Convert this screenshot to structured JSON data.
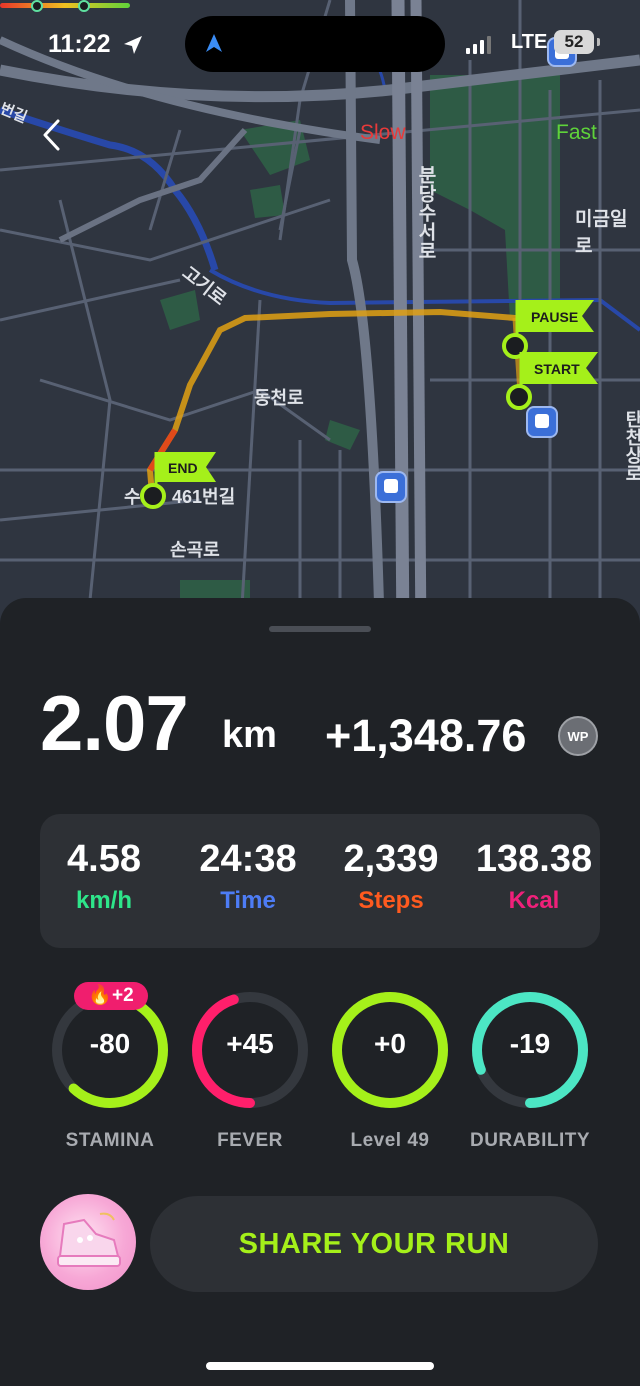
{
  "status_bar": {
    "time": "11:22",
    "network": "LTE",
    "battery": "52"
  },
  "map": {
    "legend": {
      "slow": "Slow",
      "fast": "Fast"
    },
    "road_labels": [
      "분당수서로",
      "미금일로",
      "고기로",
      "동천로",
      "수",
      "461번길",
      "손곡로",
      "탄천상로",
      "번길"
    ],
    "markers": {
      "pause": "PAUSE",
      "start": "START",
      "end": "END"
    }
  },
  "summary": {
    "distance_value": "2.07",
    "distance_unit": "km",
    "wp_amount": "+1,348.76",
    "wp_badge": "WP"
  },
  "stats": [
    {
      "value": "4.58",
      "label": "km/h",
      "color": "#2ee58a"
    },
    {
      "value": "24:38",
      "label": "Time",
      "color": "#4d7cf5"
    },
    {
      "value": "2,339",
      "label": "Steps",
      "color": "#ff5a1f"
    },
    {
      "value": "138.38",
      "label": "Kcal",
      "color": "#f0207a"
    }
  ],
  "rings": [
    {
      "value": "-80",
      "label": "STAMINA",
      "color": "#a5f01a",
      "fill": 0.62
    },
    {
      "value": "+45",
      "label": "FEVER",
      "color": "#ff1f6b",
      "fill": 0.45
    },
    {
      "value": "+0",
      "label": "Level 49",
      "color": "#a5f01a",
      "fill": 1.0
    },
    {
      "value": "-19",
      "label": "DURABILITY",
      "color": "#4ce6c4",
      "fill": 0.81
    }
  ],
  "stamina_bonus": "+2",
  "share_button": "SHARE YOUR RUN"
}
